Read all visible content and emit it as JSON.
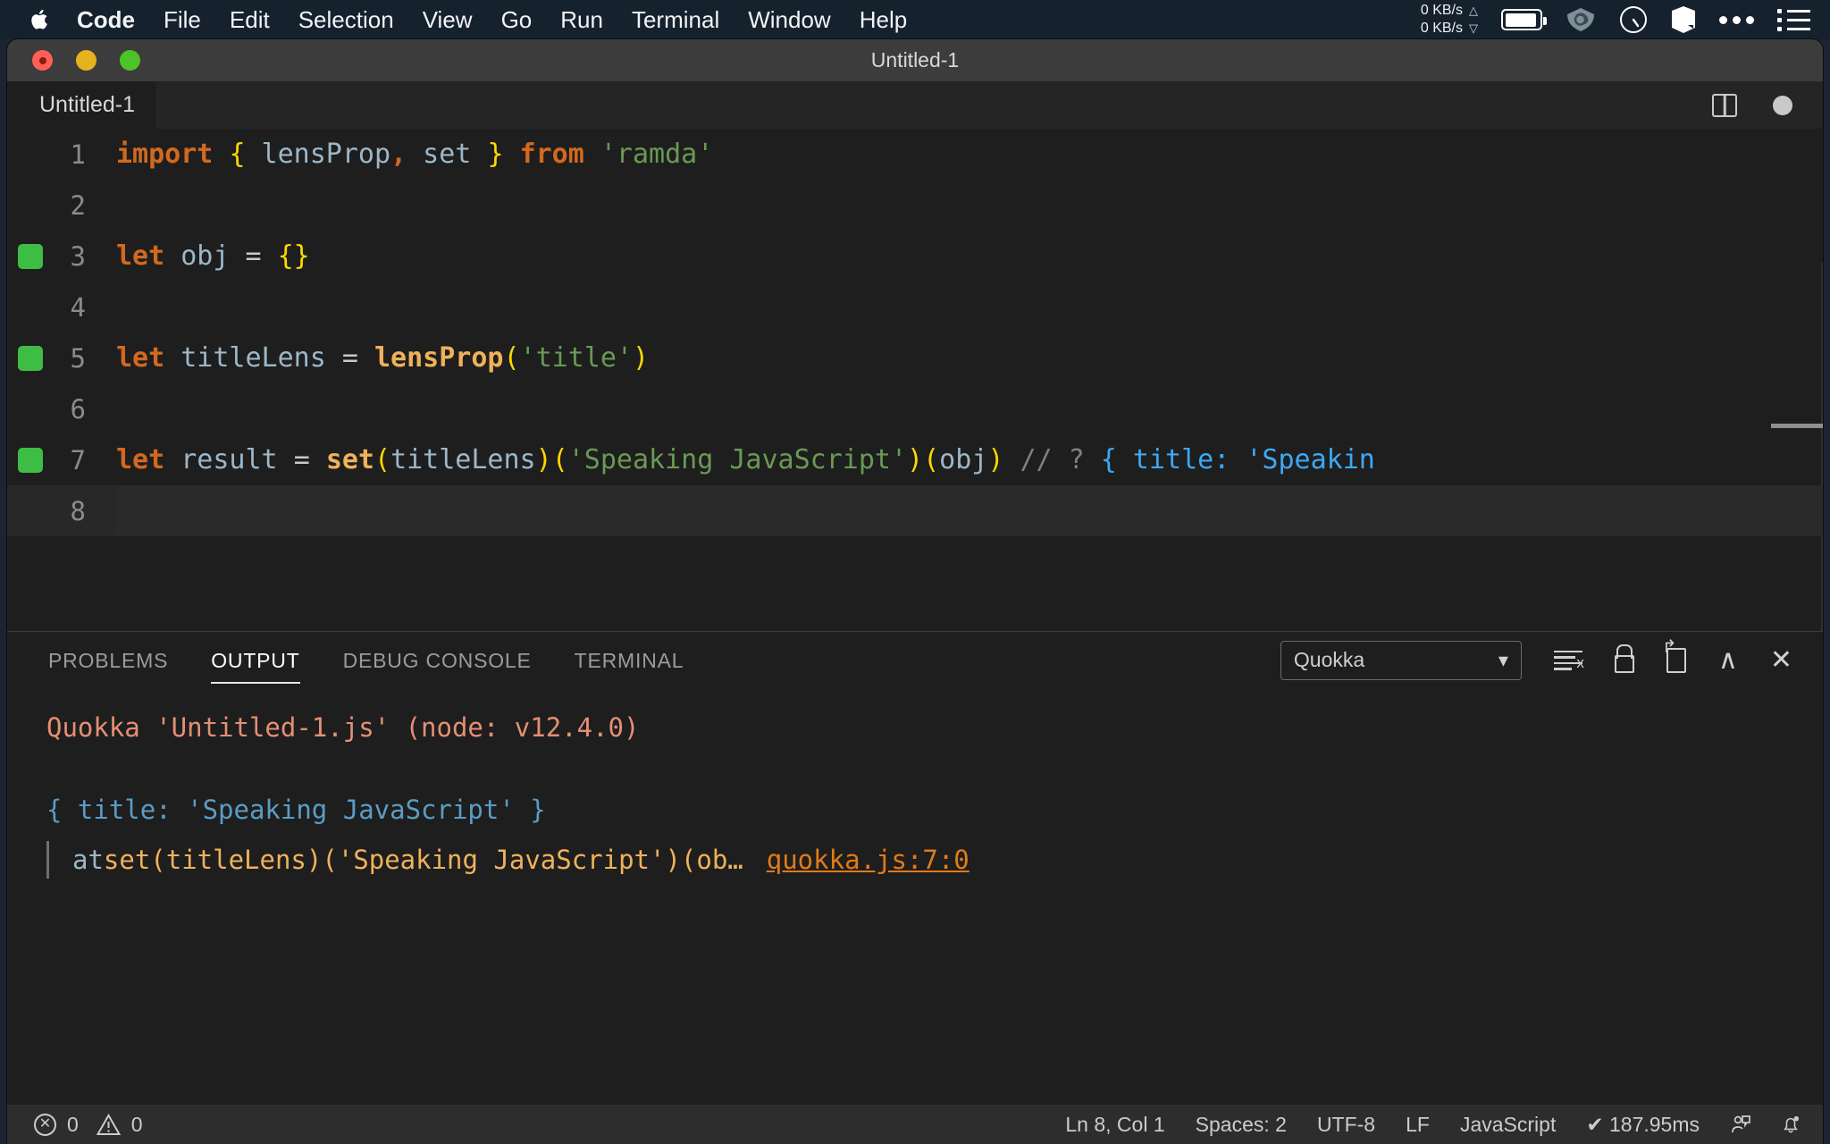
{
  "menubar": {
    "apple_icon": "apple-logo",
    "items": [
      {
        "label": "Code",
        "bold": true
      },
      {
        "label": "File",
        "bold": false
      },
      {
        "label": "Edit",
        "bold": false
      },
      {
        "label": "Selection",
        "bold": false
      },
      {
        "label": "View",
        "bold": false
      },
      {
        "label": "Go",
        "bold": false
      },
      {
        "label": "Run",
        "bold": false
      },
      {
        "label": "Terminal",
        "bold": false
      },
      {
        "label": "Window",
        "bold": false
      },
      {
        "label": "Help",
        "bold": false
      }
    ],
    "network": {
      "up": "0 KB/s",
      "down": "0 KB/s",
      "up_arrow": "△",
      "down_arrow": "▽"
    },
    "status_icons": [
      "battery-icon",
      "vpn-eye-icon",
      "speedometer-icon",
      "cube-icon",
      "ellipsis-icon",
      "list-icon"
    ]
  },
  "window": {
    "title": "Untitled-1",
    "traffic_lights": [
      "close",
      "minimize",
      "maximize"
    ]
  },
  "editor": {
    "tab_label": "Untitled-1",
    "split_icon": "split-editor-icon",
    "dirty_indicator": "unsaved-dot",
    "lines": [
      {
        "number": "1",
        "marked": false,
        "current": false,
        "tokens": [
          {
            "text": "import",
            "cls": "t-kw"
          },
          {
            "text": " ",
            "cls": "t-op"
          },
          {
            "text": "{",
            "cls": "t-brace"
          },
          {
            "text": " lensProp",
            "cls": "t-var"
          },
          {
            "text": ",",
            "cls": "t-kw"
          },
          {
            "text": " set ",
            "cls": "t-var"
          },
          {
            "text": "}",
            "cls": "t-brace"
          },
          {
            "text": " ",
            "cls": "t-op"
          },
          {
            "text": "from",
            "cls": "t-kw"
          },
          {
            "text": " ",
            "cls": "t-op"
          },
          {
            "text": "'ramda'",
            "cls": "t-str"
          }
        ]
      },
      {
        "number": "2",
        "marked": false,
        "current": false,
        "tokens": []
      },
      {
        "number": "3",
        "marked": true,
        "current": false,
        "tokens": [
          {
            "text": "let",
            "cls": "t-kw"
          },
          {
            "text": " obj ",
            "cls": "t-var"
          },
          {
            "text": "=",
            "cls": "t-op"
          },
          {
            "text": " ",
            "cls": "t-op"
          },
          {
            "text": "{}",
            "cls": "t-brace"
          }
        ]
      },
      {
        "number": "4",
        "marked": false,
        "current": false,
        "tokens": []
      },
      {
        "number": "5",
        "marked": true,
        "current": false,
        "tokens": [
          {
            "text": "let",
            "cls": "t-kw"
          },
          {
            "text": " titleLens ",
            "cls": "t-var"
          },
          {
            "text": "=",
            "cls": "t-op"
          },
          {
            "text": " ",
            "cls": "t-op"
          },
          {
            "text": "lensProp",
            "cls": "t-fn"
          },
          {
            "text": "(",
            "cls": "t-paren"
          },
          {
            "text": "'title'",
            "cls": "t-str"
          },
          {
            "text": ")",
            "cls": "t-paren"
          }
        ]
      },
      {
        "number": "6",
        "marked": false,
        "current": false,
        "tokens": []
      },
      {
        "number": "7",
        "marked": true,
        "current": false,
        "tokens": [
          {
            "text": "let",
            "cls": "t-kw"
          },
          {
            "text": " result ",
            "cls": "t-var"
          },
          {
            "text": "=",
            "cls": "t-op"
          },
          {
            "text": " ",
            "cls": "t-op"
          },
          {
            "text": "set",
            "cls": "t-fn"
          },
          {
            "text": "(",
            "cls": "t-paren"
          },
          {
            "text": "titleLens",
            "cls": "t-var"
          },
          {
            "text": ")",
            "cls": "t-paren"
          },
          {
            "text": "(",
            "cls": "t-paren"
          },
          {
            "text": "'Speaking JavaScript'",
            "cls": "t-str"
          },
          {
            "text": ")",
            "cls": "t-paren"
          },
          {
            "text": "(",
            "cls": "t-paren"
          },
          {
            "text": "obj",
            "cls": "t-var"
          },
          {
            "text": ")",
            "cls": "t-paren"
          },
          {
            "text": " // ? ",
            "cls": "t-comment"
          },
          {
            "text": "{ title: 'Speakin",
            "cls": "t-quokka"
          }
        ]
      },
      {
        "number": "8",
        "marked": false,
        "current": true,
        "tokens": []
      }
    ]
  },
  "panel": {
    "tabs": [
      {
        "label": "PROBLEMS",
        "active": false
      },
      {
        "label": "OUTPUT",
        "active": true
      },
      {
        "label": "DEBUG CONSOLE",
        "active": false
      },
      {
        "label": "TERMINAL",
        "active": false
      }
    ],
    "channel_select": {
      "value": "Quokka",
      "chevron": "⌄"
    },
    "tool_icons": [
      "clear-output-icon",
      "lock-scroll-icon",
      "open-in-editor-icon",
      "maximize-panel-icon",
      "close-panel-icon"
    ],
    "maximize_glyph": "∧",
    "close_glyph": "✕",
    "output": {
      "header": "Quokka 'Untitled-1.js' (node: v12.4.0)",
      "result": "{ title: 'Speaking JavaScript' }",
      "stack_at": "at ",
      "stack_body": "set(titleLens)('Speaking JavaScript')(ob…",
      "stack_link": "quokka.js:7:0"
    }
  },
  "statusbar": {
    "errors": "0",
    "warnings": "0",
    "error_icon": "error-circle-icon",
    "warning_icon": "warning-triangle-icon",
    "position": "Ln 8, Col 1",
    "indentation": "Spaces: 2",
    "encoding": "UTF-8",
    "eol": "LF",
    "language": "JavaScript",
    "quokka_time": "✔ 187.95ms",
    "feedback_icon": "feedback-person-icon",
    "bell_icon": "notifications-bell-icon"
  },
  "colors": {
    "menubar_bg": "#16212e",
    "titlebar_bg": "#3c3c3c",
    "editor_bg": "#1e1e1e",
    "statusbar_bg": "#2d2d2d",
    "keyword": "#d2691e",
    "string": "#6a9955",
    "brace": "#ffd700",
    "function": "#f0b15a",
    "variable": "#9cb7c9",
    "comment": "#808080",
    "quokka_inline": "#3da8f5",
    "quokka_header": "#e58f73",
    "output_result": "#5a9dc4",
    "link": "#e07b18",
    "coverage_marker": "#3ebd45"
  }
}
